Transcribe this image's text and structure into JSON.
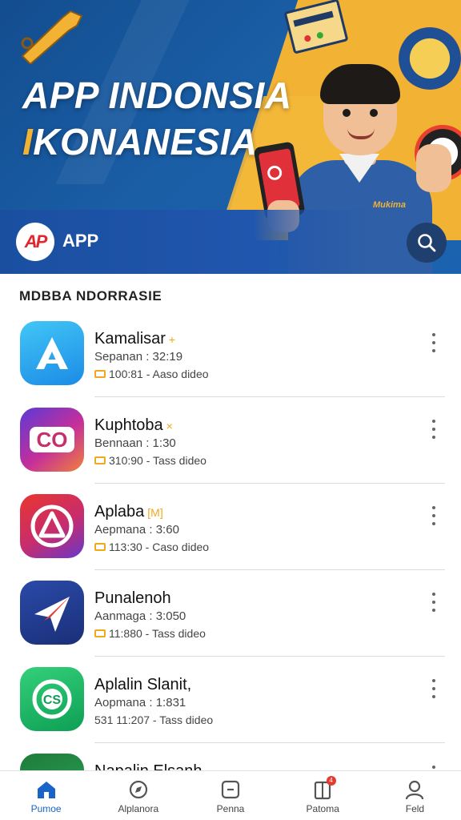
{
  "hero": {
    "title_line1": "APP INDONSIA",
    "title_line2_accent": "I",
    "title_line2_rest": "KONANESIA",
    "brand_logo_text": "AP",
    "brand_name": "APP",
    "shirt_tag": "Mukima"
  },
  "section": {
    "title": "MDBBA NDORRASIE"
  },
  "apps": [
    {
      "name": "Kamalisar",
      "badge": "+",
      "sub": "Sepanan : 32:19",
      "meta": "100:81 - Aaso dideo",
      "icon": "triangle-a-icon"
    },
    {
      "name": "Kuphtoba",
      "badge": "×",
      "sub": "Bennaan : 1:30",
      "meta": "310:90 - Tass dideo",
      "icon": "co-icon"
    },
    {
      "name": "Aplaba",
      "badge": "[M]",
      "sub": "Aepmana : 3:60",
      "meta": "113:30 - Caso dideo",
      "icon": "circle-a-icon"
    },
    {
      "name": "Punalenoh",
      "badge": "",
      "sub": "Aanmaga : 3:050",
      "meta": "11:880 - Tass dideo",
      "icon": "paper-plane-icon"
    },
    {
      "name": "Aplalin Slanit,",
      "badge": "",
      "sub": "Aopmana : 1:831",
      "meta": "531 11:207 - Tass dideo",
      "icon": "chat-cs-icon"
    },
    {
      "name": "Napalin Elsanh",
      "badge": "",
      "sub": "",
      "meta": "",
      "icon": "person-icon"
    }
  ],
  "nav": [
    {
      "label": "Pumoe",
      "icon": "home-icon",
      "active": true
    },
    {
      "label": "Alplanora",
      "icon": "explore-icon",
      "active": false
    },
    {
      "label": "Penna",
      "icon": "app-box-icon",
      "active": false
    },
    {
      "label": "Patoma",
      "icon": "book-icon",
      "active": false,
      "badge": "4"
    },
    {
      "label": "Feld",
      "icon": "profile-icon",
      "active": false
    }
  ],
  "colors": {
    "primary": "#1a63c9",
    "hero_blue": "#1a5ea6",
    "hero_yellow": "#f2b233",
    "badge_red": "#e63a2e"
  }
}
